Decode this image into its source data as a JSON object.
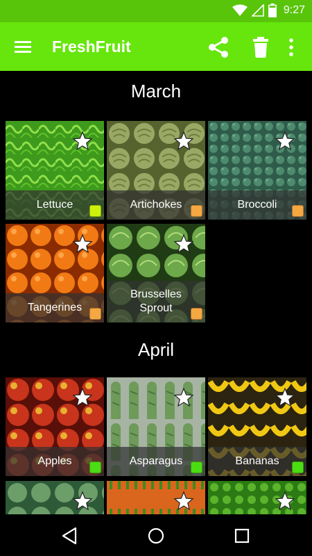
{
  "status_bar": {
    "time": "9:27"
  },
  "app_bar": {
    "title": "FreshFruit",
    "bg_color": "#66e60c",
    "actions": [
      "share-icon",
      "trash-icon",
      "more-vert-icon"
    ]
  },
  "sections": [
    {
      "title": "March",
      "items": [
        {
          "label": "Lettuce",
          "indicator_color": "#ccf20c",
          "photo": "lettuce"
        },
        {
          "label": "Artichokes",
          "indicator_color": "#f5a742",
          "photo": "artichokes"
        },
        {
          "label": "Broccoli",
          "indicator_color": "#f5a742",
          "photo": "broccoli"
        },
        {
          "label": "Tangerines",
          "indicator_color": "#f5a742",
          "photo": "tangerines"
        },
        {
          "label": "Brusselles Sprout",
          "indicator_color": "#f5a742",
          "photo": "brussels-sprouts"
        }
      ]
    },
    {
      "title": "April",
      "items": [
        {
          "label": "Apples",
          "indicator_color": "#4cdc14",
          "photo": "apples"
        },
        {
          "label": "Asparagus",
          "indicator_color": "#4cdc14",
          "photo": "asparagus"
        },
        {
          "label": "Bananas",
          "indicator_color": "#4cdc14",
          "photo": "bananas"
        },
        {
          "label": "",
          "indicator_color": "",
          "photo": "cabbage"
        },
        {
          "label": "",
          "indicator_color": "",
          "photo": "carrots"
        },
        {
          "label": "",
          "indicator_color": "",
          "photo": "parsley"
        }
      ]
    }
  ],
  "nav_bar": {
    "buttons": [
      "back-icon",
      "home-icon",
      "recents-icon"
    ]
  }
}
